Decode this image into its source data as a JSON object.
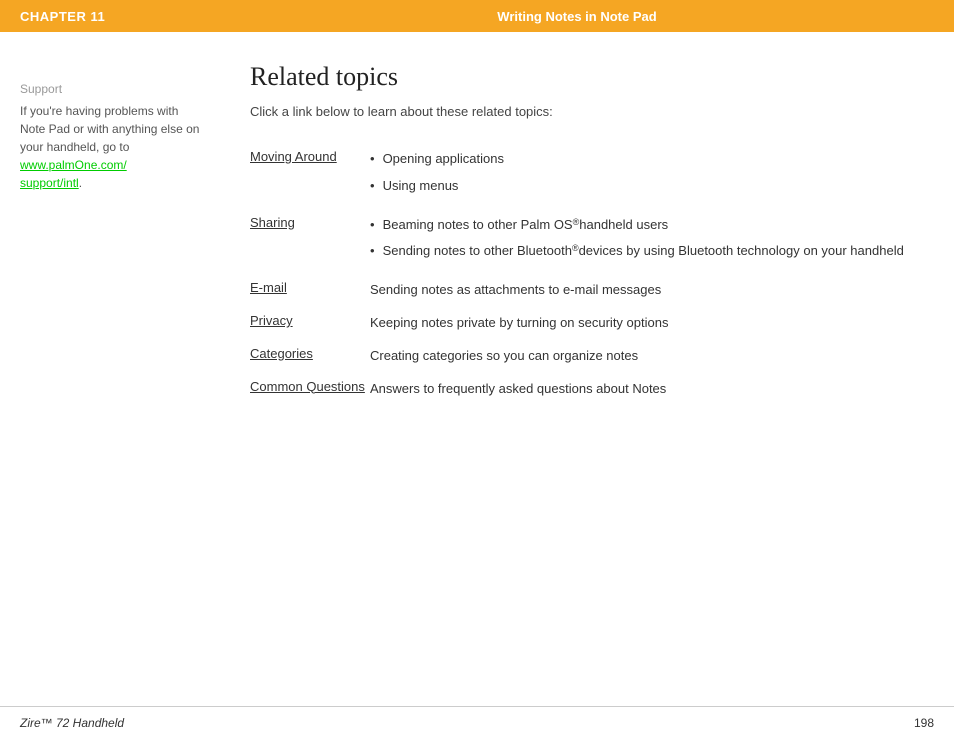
{
  "header": {
    "chapter_label": "CHAPTER 11",
    "title": "Writing Notes in Note Pad"
  },
  "sidebar": {
    "support_label": "Support",
    "support_text_1": "If you're having problems with Note Pad or with anything else on your handheld, go to ",
    "support_link_text": "www.palmOne.com/support/intl",
    "support_link_href": "www.palmOne.com/support/intl"
  },
  "main": {
    "page_title": "Related topics",
    "intro": "Click a link below to learn about these related topics:",
    "topics": [
      {
        "link": "Moving Around",
        "bullets": [
          "Opening applications",
          "Using menus"
        ],
        "desc": null
      },
      {
        "link": "Sharing",
        "bullets": [
          "Beaming notes to other Palm OS® handheld users",
          "Sending notes to other Bluetooth® devices by using Bluetooth technology on your handheld"
        ],
        "desc": null
      },
      {
        "link": "E-mail",
        "bullets": null,
        "desc": "Sending notes as attachments to e-mail messages"
      },
      {
        "link": "Privacy",
        "bullets": null,
        "desc": "Keeping notes private by turning on security options"
      },
      {
        "link": "Categories",
        "bullets": null,
        "desc": "Creating categories so you can organize notes"
      },
      {
        "link": "Common Questions",
        "bullets": null,
        "desc": "Answers to frequently asked questions about Notes"
      }
    ]
  },
  "footer": {
    "brand": "Zire™ 72 Handheld",
    "page_number": "198"
  }
}
